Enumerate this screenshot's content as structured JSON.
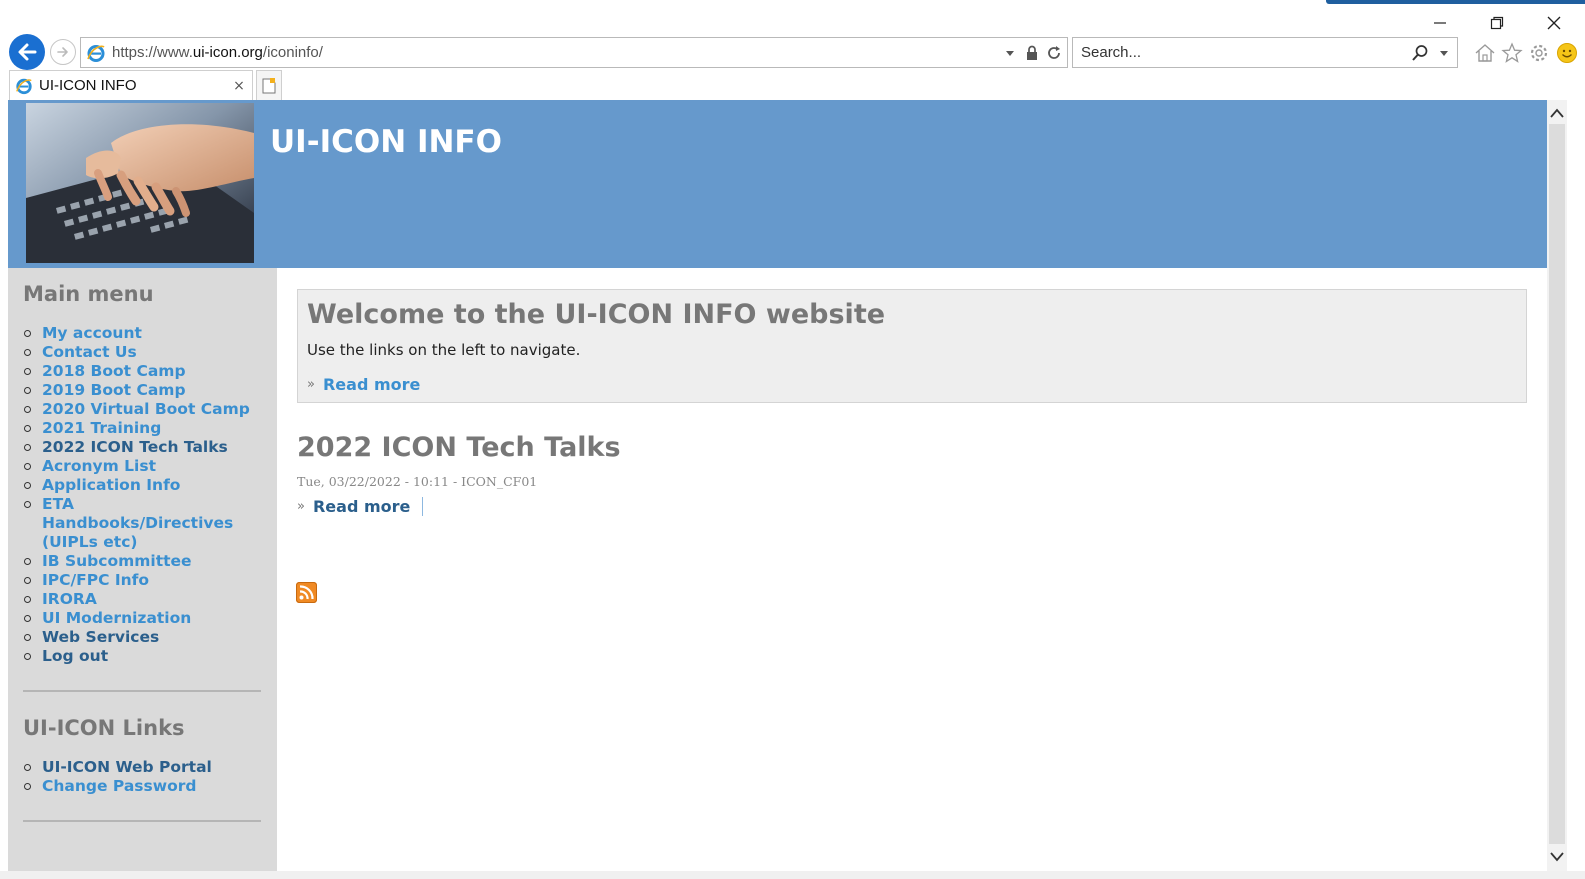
{
  "browser": {
    "url_prefix": "https://www.",
    "url_domain": "ui-icon.org",
    "url_path": "/iconinfo/",
    "search_placeholder": "Search...",
    "tab_title": "UI-ICON INFO",
    "tab_close": "×"
  },
  "site": {
    "title": "UI-ICON INFO"
  },
  "sidebar": {
    "main_menu_title": "Main menu",
    "main_menu_items": [
      {
        "label": "My account"
      },
      {
        "label": "Contact Us"
      },
      {
        "label": "2018 Boot Camp"
      },
      {
        "label": "2019 Boot Camp"
      },
      {
        "label": "2020 Virtual Boot Camp"
      },
      {
        "label": "2021 Training"
      },
      {
        "label": "2022 ICON Tech Talks"
      },
      {
        "label": "Acronym List"
      },
      {
        "label": "Application Info"
      },
      {
        "label": "ETA Handbooks/Directives (UIPLs etc)"
      },
      {
        "label": "IB Subcommittee"
      },
      {
        "label": "IPC/FPC Info"
      },
      {
        "label": "IRORA"
      },
      {
        "label": "UI Modernization"
      },
      {
        "label": "Web Services"
      },
      {
        "label": "Log out"
      }
    ],
    "links_title": "UI-ICON Links",
    "links_items": [
      {
        "label": "UI-ICON Web Portal"
      },
      {
        "label": "Change Password"
      }
    ]
  },
  "main": {
    "welcome_title": "Welcome to the UI-ICON INFO website",
    "welcome_text": "Use the links on the left to navigate.",
    "welcome_read_more": "Read more",
    "raquo": "»",
    "article_title": "2022 ICON Tech Talks",
    "article_meta": "Tue, 03/22/2022 - 10:11 - ICON_CF01",
    "article_read_more": "Read more"
  },
  "colors": {
    "header_bg": "#6699cc",
    "sidebar_bg": "#dadada",
    "link": "#3a8fd0",
    "link_dark": "#2b5f8c",
    "ie_back": "#1a6fd1"
  },
  "icons": [
    "back-arrow-icon",
    "forward-arrow-icon",
    "ie-logo-icon",
    "dropdown-icon",
    "lock-icon",
    "refresh-icon",
    "search-icon",
    "home-icon",
    "star-icon",
    "gear-icon",
    "smiley-icon",
    "close-icon",
    "new-tab-icon",
    "rss-icon"
  ]
}
